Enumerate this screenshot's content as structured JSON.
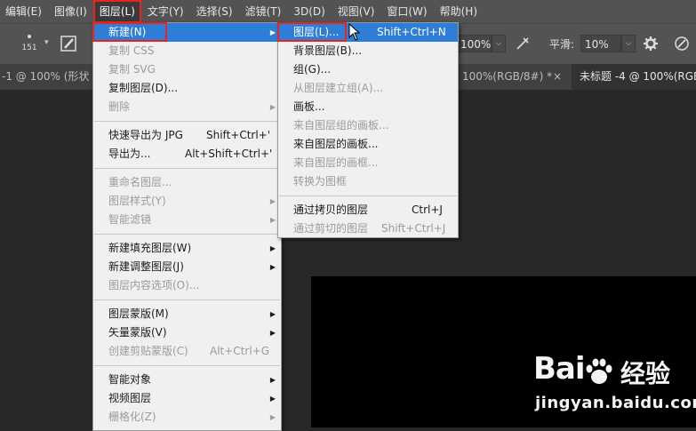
{
  "menubar": {
    "items": [
      "编辑(E)",
      "图像(I)",
      "图层(L)",
      "文字(Y)",
      "选择(S)",
      "滤镜(T)",
      "3D(D)",
      "视图(V)",
      "窗口(W)",
      "帮助(H)"
    ]
  },
  "options": {
    "brush_size": "151",
    "zoom_value": "100%",
    "smooth_label": "平滑:",
    "smooth_value": "10%"
  },
  "tabs": {
    "left_tab": "-1 @ 100% (形状",
    "middle_tab": "100%(RGB/8#) *",
    "close": "×",
    "right_tab": "未标题 -4 @ 100%(RGB"
  },
  "layer_menu": {
    "items": [
      {
        "label": "新建(N)",
        "shortcut": "",
        "state": "highlight",
        "submenu": true
      },
      {
        "label": "复制 CSS",
        "shortcut": "",
        "state": "disabled",
        "submenu": false
      },
      {
        "label": "复制 SVG",
        "shortcut": "",
        "state": "disabled",
        "submenu": false
      },
      {
        "label": "复制图层(D)...",
        "shortcut": "",
        "state": "enabled",
        "submenu": false
      },
      {
        "label": "删除",
        "shortcut": "",
        "state": "disabled",
        "submenu": true
      },
      {
        "sep": true
      },
      {
        "label": "快速导出为 JPG",
        "shortcut": "Shift+Ctrl+'",
        "state": "enabled",
        "submenu": false
      },
      {
        "label": "导出为...",
        "shortcut": "Alt+Shift+Ctrl+'",
        "state": "enabled",
        "submenu": false
      },
      {
        "sep": true
      },
      {
        "label": "重命名图层...",
        "shortcut": "",
        "state": "disabled",
        "submenu": false
      },
      {
        "label": "图层样式(Y)",
        "shortcut": "",
        "state": "disabled",
        "submenu": true
      },
      {
        "label": "智能滤镜",
        "shortcut": "",
        "state": "disabled",
        "submenu": true
      },
      {
        "sep": true
      },
      {
        "label": "新建填充图层(W)",
        "shortcut": "",
        "state": "enabled",
        "submenu": true
      },
      {
        "label": "新建调整图层(J)",
        "shortcut": "",
        "state": "enabled",
        "submenu": true
      },
      {
        "label": "图层内容选项(O)...",
        "shortcut": "",
        "state": "disabled",
        "submenu": false
      },
      {
        "sep": true
      },
      {
        "label": "图层蒙版(M)",
        "shortcut": "",
        "state": "enabled",
        "submenu": true
      },
      {
        "label": "矢量蒙版(V)",
        "shortcut": "",
        "state": "enabled",
        "submenu": true
      },
      {
        "label": "创建剪贴蒙版(C)",
        "shortcut": "Alt+Ctrl+G",
        "state": "disabled",
        "submenu": false
      },
      {
        "sep": true
      },
      {
        "label": "智能对象",
        "shortcut": "",
        "state": "enabled",
        "submenu": true
      },
      {
        "label": "视频图层",
        "shortcut": "",
        "state": "enabled",
        "submenu": true
      },
      {
        "label": "栅格化(Z)",
        "shortcut": "",
        "state": "disabled",
        "submenu": true
      }
    ]
  },
  "new_submenu": {
    "items": [
      {
        "label": "图层(L)...",
        "shortcut": "Shift+Ctrl+N",
        "state": "highlight"
      },
      {
        "label": "背景图层(B)...",
        "shortcut": "",
        "state": "enabled"
      },
      {
        "label": "组(G)...",
        "shortcut": "",
        "state": "enabled"
      },
      {
        "label": "从图层建立组(A)...",
        "shortcut": "",
        "state": "disabled"
      },
      {
        "label": "画板...",
        "shortcut": "",
        "state": "enabled"
      },
      {
        "label": "来自图层组的画板...",
        "shortcut": "",
        "state": "disabled"
      },
      {
        "label": "来自图层的画板...",
        "shortcut": "",
        "state": "enabled"
      },
      {
        "label": "来自图层的画框...",
        "shortcut": "",
        "state": "disabled"
      },
      {
        "label": "转换为图框",
        "shortcut": "",
        "state": "disabled"
      },
      {
        "sep": true
      },
      {
        "label": "通过拷贝的图层",
        "shortcut": "Ctrl+J",
        "state": "enabled"
      },
      {
        "label": "通过剪切的图层",
        "shortcut": "Shift+Ctrl+J",
        "state": "disabled"
      }
    ]
  },
  "watermark": {
    "brand_left": "Bai",
    "brand_right": "经验",
    "url": "jingyan.baidu.com"
  },
  "colors": {
    "accent": "#2e7ed8",
    "annotation_red": "#e8241b",
    "menubar_bg": "#535353",
    "menu_bg": "#f0f0f0"
  }
}
